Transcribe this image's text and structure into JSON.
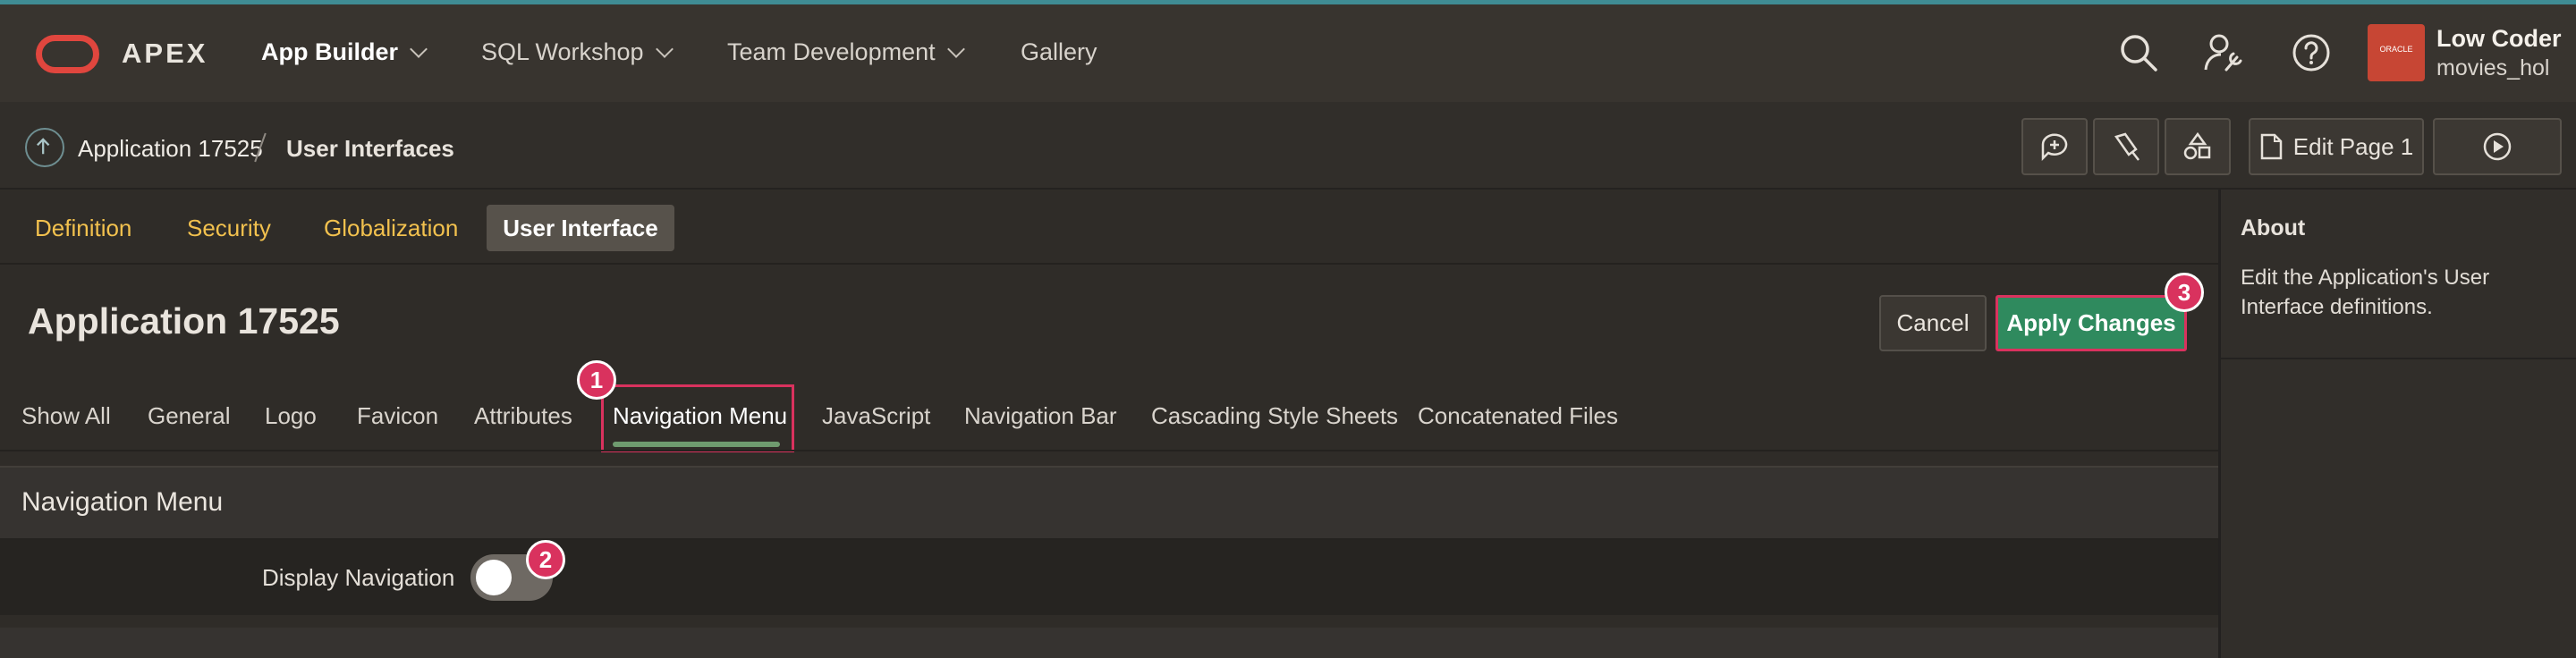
{
  "header": {
    "brand": "APEX",
    "nav": [
      {
        "label": "App Builder",
        "has_menu": true,
        "active": true
      },
      {
        "label": "SQL Workshop",
        "has_menu": true
      },
      {
        "label": "Team Development",
        "has_menu": true
      },
      {
        "label": "Gallery",
        "has_menu": false
      }
    ],
    "icons": [
      "search-icon",
      "user-wrench-icon",
      "help-icon"
    ],
    "user": {
      "badge": "ORACLE",
      "name": "Low Coder",
      "workspace": "movies_hol"
    }
  },
  "breadcrumb": {
    "items": [
      "Application 17525",
      "User Interfaces"
    ]
  },
  "toolbar": {
    "edit_page_label": "Edit Page 1",
    "icons": [
      "comment-add-icon",
      "flashlight-icon",
      "shapes-icon",
      "page-edit-icon",
      "play-icon"
    ]
  },
  "subnav": {
    "links": [
      "Definition",
      "Security",
      "Globalization"
    ],
    "active": "User Interface"
  },
  "page": {
    "title": "Application 17525",
    "cancel_label": "Cancel",
    "apply_label": "Apply Changes"
  },
  "tabs": {
    "items": [
      "Show All",
      "General",
      "Logo",
      "Favicon",
      "Attributes",
      "Navigation Menu",
      "JavaScript",
      "Navigation Bar",
      "Cascading Style Sheets",
      "Concatenated Files"
    ],
    "active": "Navigation Menu"
  },
  "region": {
    "title": "Navigation Menu",
    "field_label": "Display Navigation",
    "toggle_on": false
  },
  "callouts": [
    "1",
    "2",
    "3"
  ],
  "side": {
    "title": "About",
    "text": "Edit the Application's User Interface definitions."
  },
  "colors": {
    "accent_red": "#d9325e",
    "apply_green": "#2f8a5e",
    "link_yellow": "#f2c14e",
    "oracle_red": "#c74634"
  }
}
